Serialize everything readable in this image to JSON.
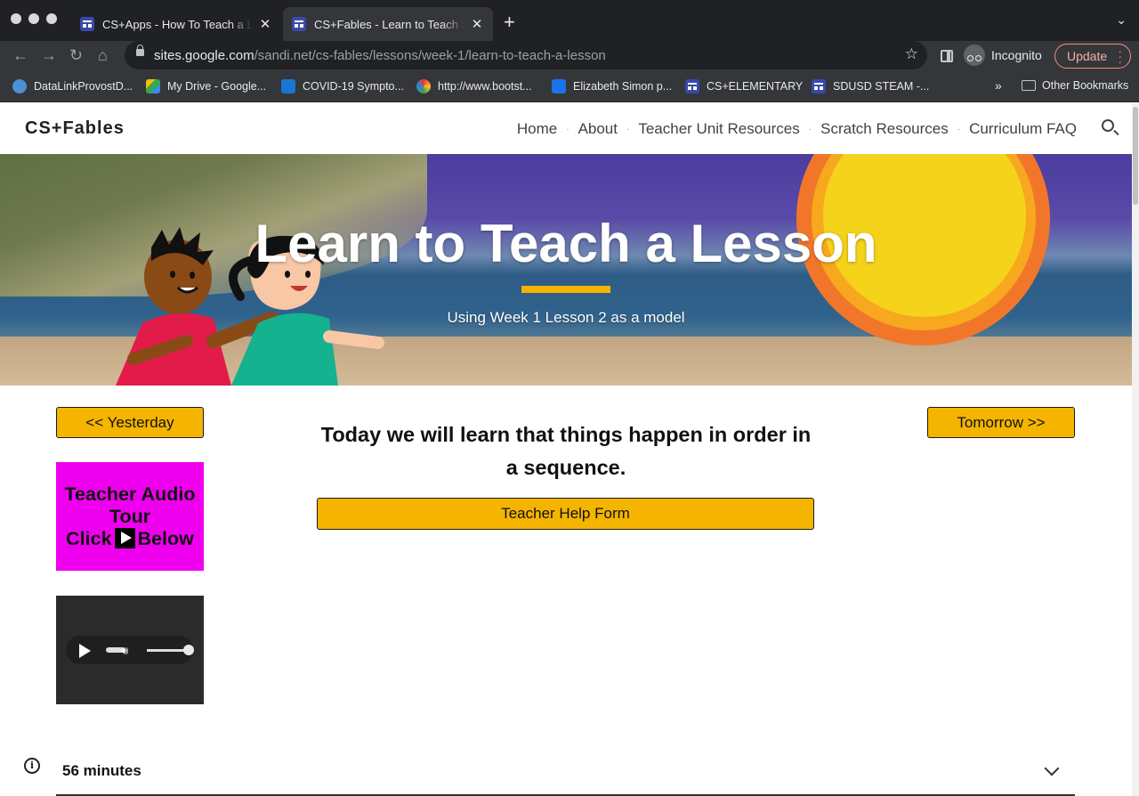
{
  "browser": {
    "tabs": [
      {
        "title": "CS+Apps - How To Teach a Lesson",
        "active": false
      },
      {
        "title": "CS+Fables - Learn to Teach a Lesson",
        "active": true
      }
    ],
    "tab_close_glyph": "✕",
    "new_tab_glyph": "+",
    "tab_menu_glyph": "⌄",
    "url_host": "sites.google.com",
    "url_path": "/sandi.net/cs-fables/lessons/week-1/learn-to-teach-a-lesson",
    "incognito_label": "Incognito",
    "update_label": "Update",
    "bookmarks": [
      {
        "label": "DataLinkProvostD...",
        "icon_color": "#4a90d9"
      },
      {
        "label": "My Drive - Google...",
        "icon_color": "#34a853"
      },
      {
        "label": "COVID-19 Sympto...",
        "icon_color": "#1976d2"
      },
      {
        "label": "http://www.bootst...",
        "icon_color": "#9c27b0"
      },
      {
        "label": "Elizabeth Simon p...",
        "icon_color": "#1a73e8"
      },
      {
        "label": "CS+ELEMENTARY",
        "icon_color": "#3949ab"
      },
      {
        "label": "SDUSD STEAM -...",
        "icon_color": "#3949ab"
      }
    ],
    "bookmarks_overflow": "»",
    "other_bookmarks": "Other Bookmarks"
  },
  "site": {
    "title": "CS+Fables",
    "nav": [
      "Home",
      "About",
      "Teacher Unit Resources",
      "Scratch Resources",
      "Curriculum FAQ"
    ],
    "nav_separator": "·"
  },
  "hero": {
    "title": "Learn to Teach a Lesson",
    "subtitle": "Using Week 1 Lesson 2 as a model"
  },
  "content": {
    "yesterday_label": "<< Yesterday",
    "tomorrow_label": "Tomorrow >>",
    "audio_tour_line1": "Teacher Audio",
    "audio_tour_line2": "Tour",
    "audio_tour_line3a": "Click",
    "audio_tour_line3b": "Below",
    "heading": "Today we will learn that things happen in order in a sequence.",
    "help_form_label": "Teacher Help Form",
    "duration": "56 minutes",
    "info_glyph": "i"
  },
  "colors": {
    "accent_gold": "#f4b400",
    "audio_tour_bg": "#ee00ee",
    "browser_dark": "#202124"
  }
}
